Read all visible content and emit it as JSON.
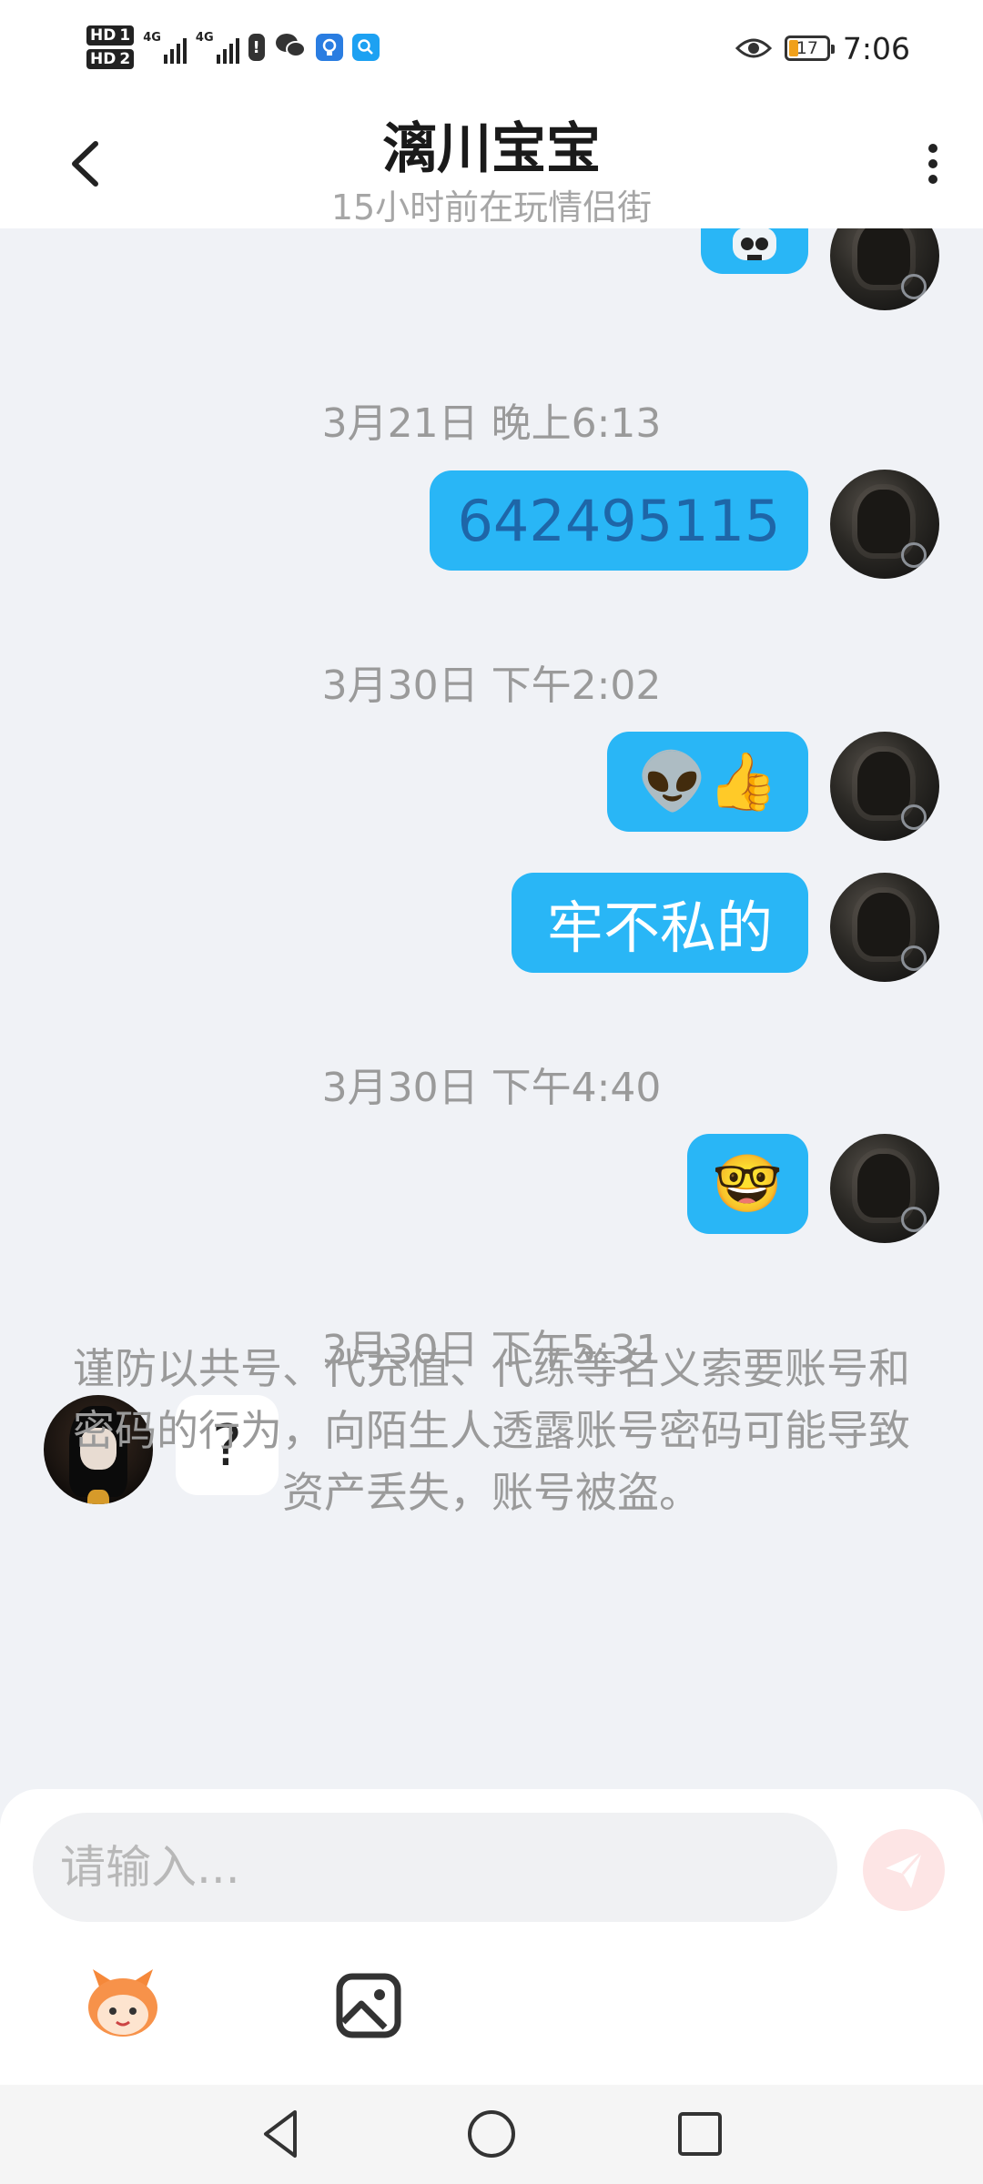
{
  "status_bar": {
    "network": "4G",
    "hd1": "HD",
    "sim1": "1",
    "hd2": "HD",
    "sim2": "2",
    "battery": "17",
    "time": "7:06"
  },
  "header": {
    "title": "漓川宝宝",
    "subtitle": "15小时前在玩情侣街"
  },
  "messages": {
    "ts1": "3月21日 晚上6:13",
    "m1": "642495115",
    "ts2": "3月30日 下午2:02",
    "m2": "👽👍",
    "m3": "牢不私的",
    "ts3": "3月30日 下午4:40",
    "m4": "🤓",
    "ts4": "3月30日 下午5:31",
    "m5": "?"
  },
  "notice": "谨防以共号、代充值、代练等名义索要账号和密码的行为，向陌生人透露账号密码可能导致资产丢失，账号被盗。",
  "input": {
    "placeholder": "请输入..."
  },
  "colors": {
    "bubble_out": "#29b6f6",
    "background": "#f0f2f6",
    "send_disabled": "#fde5e5"
  }
}
